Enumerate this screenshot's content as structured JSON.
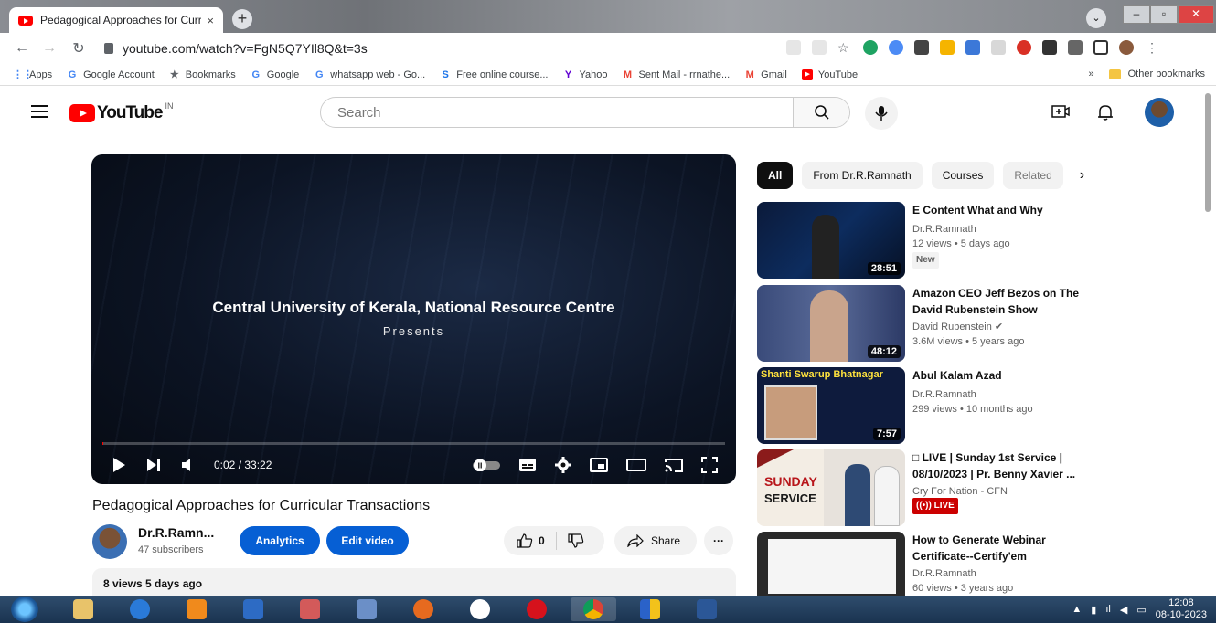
{
  "browser": {
    "tab_title": "Pedagogical Approaches for Curr",
    "tab_close": "×",
    "new_tab": "+",
    "url": "youtube.com/watch?v=FgN5Q7YIl8Q&t=3s",
    "window_controls": [
      "–",
      "▫",
      "✕"
    ]
  },
  "bookmarks": {
    "items": [
      {
        "label": "Apps",
        "icon": "apps-grid-icon",
        "color": "#4285f4"
      },
      {
        "label": "Google Account",
        "icon": "google-icon",
        "color": "#4285f4"
      },
      {
        "label": "Bookmarks",
        "icon": "star-icon",
        "color": "#5f6368"
      },
      {
        "label": "Google",
        "icon": "google-icon",
        "color": "#4285f4"
      },
      {
        "label": "whatsapp web - Go...",
        "icon": "google-icon",
        "color": "#4285f4"
      },
      {
        "label": "Free online course...",
        "icon": "s-icon",
        "color": "#1a73e8"
      },
      {
        "label": "Yahoo",
        "icon": "yahoo-icon",
        "color": "#6001d2"
      },
      {
        "label": "Sent Mail - rrnathe...",
        "icon": "gmail-icon",
        "color": "#ea4335"
      },
      {
        "label": "Gmail",
        "icon": "gmail-icon",
        "color": "#ea4335"
      },
      {
        "label": "YouTube",
        "icon": "youtube-icon",
        "color": "#ff0000"
      }
    ],
    "overflow": "»",
    "other": "Other bookmarks"
  },
  "youtube": {
    "logo_word": "YouTube",
    "country": "IN",
    "search_placeholder": "Search"
  },
  "player": {
    "line1": "Central University of Kerala, National Resource Centre",
    "line2": "Presents",
    "time": "0:02 / 33:22",
    "progress": 0.001
  },
  "video": {
    "title": "Pedagogical Approaches for Curricular Transactions",
    "channel": "Dr.R.Ramn...",
    "subscribers": "47 subscribers",
    "analytics": "Analytics",
    "edit": "Edit video",
    "likes": "0",
    "share": "Share",
    "more": "···",
    "description_stats": "8 views  5 days ago"
  },
  "chips": [
    "All",
    "From Dr.R.Ramnath",
    "Courses",
    "Related"
  ],
  "recommendations": [
    {
      "title": "E Content What and Why",
      "channel": "Dr.R.Ramnath",
      "stats": "12 views  •  5 days ago",
      "badge": "New",
      "duration": "28:51"
    },
    {
      "title": "Amazon CEO Jeff Bezos on The David Rubenstein Show",
      "channel": "David Rubenstein ✔",
      "stats": "3.6M views  •  5 years ago",
      "duration": "48:12"
    },
    {
      "title": "Abul Kalam Azad",
      "channel": "Dr.R.Ramnath",
      "stats": "299 views  •  10 months ago",
      "duration": "7:57",
      "thumb_text": "Shanti Swarup Bhatnagar"
    },
    {
      "title": "□ LIVE | Sunday 1st Service | 08/10/2023 | Pr. Benny Xavier ...",
      "channel": "Cry For Nation - CFN",
      "live": "((•)) LIVE",
      "thumb_text1": "SUNDAY",
      "thumb_text2": "SERVICE"
    },
    {
      "title": "How to Generate Webinar Certificate--Certify'em",
      "channel": "Dr.R.Ramnath",
      "stats": "60 views  •  3 years ago"
    }
  ],
  "taskbar": {
    "time": "12:08",
    "date": "08-10-2023"
  }
}
